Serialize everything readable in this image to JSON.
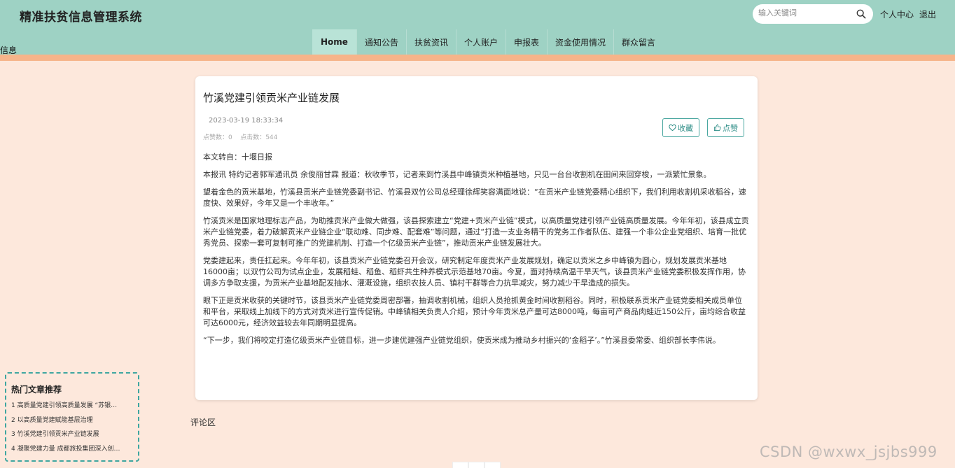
{
  "header": {
    "site_title": "精准扶贫信息管理系统",
    "search_placeholder": "输入关键词",
    "user_center": "个人中心",
    "logout": "退出",
    "overlap_text": "信息"
  },
  "nav": {
    "items": [
      {
        "label": "Home"
      },
      {
        "label": "通知公告"
      },
      {
        "label": "扶贫资讯"
      },
      {
        "label": "个人账户"
      },
      {
        "label": "申报表"
      },
      {
        "label": "资金使用情况"
      },
      {
        "label": "群众留言"
      }
    ],
    "active_index": 0
  },
  "article": {
    "title": "竹溪党建引领贡米产业链发展",
    "date": "2023-03-19 18:33:34",
    "likes_label": "点赞数：0",
    "clicks_label": "点击数：544",
    "favorite_label": "收藏",
    "like_label": "点赞",
    "paragraphs": [
      "本文转自：十堰日报",
      "本报讯 特约记者郭军通讯员 余俊丽甘霖 报道：秋收季节，记者来到竹溪县中峰镇贡米种植基地，只见一台台收割机在田间来回穿梭，一派繁忙景象。",
      "望着金色的贡米基地，竹溪县贡米产业链党委副书记、竹溪县双竹公司总经理徐辉笑容满面地说：“在贡米产业链党委精心组织下，我们利用收割机采收稻谷，速度快、效果好，今年又是一个丰收年。”",
      "竹溪贡米是国家地理标志产品，为助推贡米产业做大做强，该县探索建立“党建+贡米产业链”模式，以高质量党建引领产业链高质量发展。今年年初，该县成立贡米产业链党委，着力破解贡米产业链企业“联动难、同步难、配套难”等问题，通过“打造一支业务精干的党务工作者队伍、建强一个非公企业党组织、培育一批优秀党员、探索一套可复制可推广的党建机制、打造一个亿级贡米产业链”，推动贡米产业链发展壮大。",
      "党委建起来，责任扛起来。今年年初，该县贡米产业链党委召开会议，研究制定年度贡米产业发展规划，确定以贡米之乡中峰镇为圆心，规划发展贡米基地16000亩；以双竹公司为试点企业，发展稻蛙、稻鱼、稻虾共生种养模式示范基地70亩。今夏，面对持续高温干旱天气，该县贡米产业链党委积极发挥作用，协调多方争取支援，为贡米产业基地配发抽水、灌溉设施，组织农技人员、镇村干群等合力抗旱减灾，努力减少干旱造成的损失。",
      "眼下正是贡米收获的关键时节，该县贡米产业链党委周密部署，抽调收割机械，组织人员抢抓黄金时间收割稻谷。同时，积极联系贡米产业链党委相关成员单位和平台，采取线上加线下的方式对贡米进行宣传促销。中峰镇相关负责人介绍，预计今年贡米总产量可达8000吨，每亩可产商品肉蛙近150公斤，亩均综合收益可达6000元，经济效益较去年同期明显提高。",
      "“下一步，我们将咬定打造亿级贡米产业链目标，进一步建优建强产业链党组织，使贡米成为推动乡村振兴的‘金稻子’。”竹溪县委常委、组织部长李伟说。"
    ]
  },
  "comments": {
    "label": "评论区"
  },
  "hot_articles": {
    "title": "热门文章推荐",
    "items": [
      "1  高质量党建引领高质量发展 “苏银…",
      "2  以高质量党建赋能基层治理",
      "3  竹溪党建引领贡米产业链发展",
      "4  凝聚党建力量 成都旅投集团深入创…"
    ]
  },
  "watermark": "CSDN @wxwx_jsjbs999",
  "colors": {
    "header_bg": "#9ed2c4",
    "page_bg": "#fde8dc",
    "accent_stripe": "#f6b48a",
    "button_border": "#4aa7a0"
  }
}
